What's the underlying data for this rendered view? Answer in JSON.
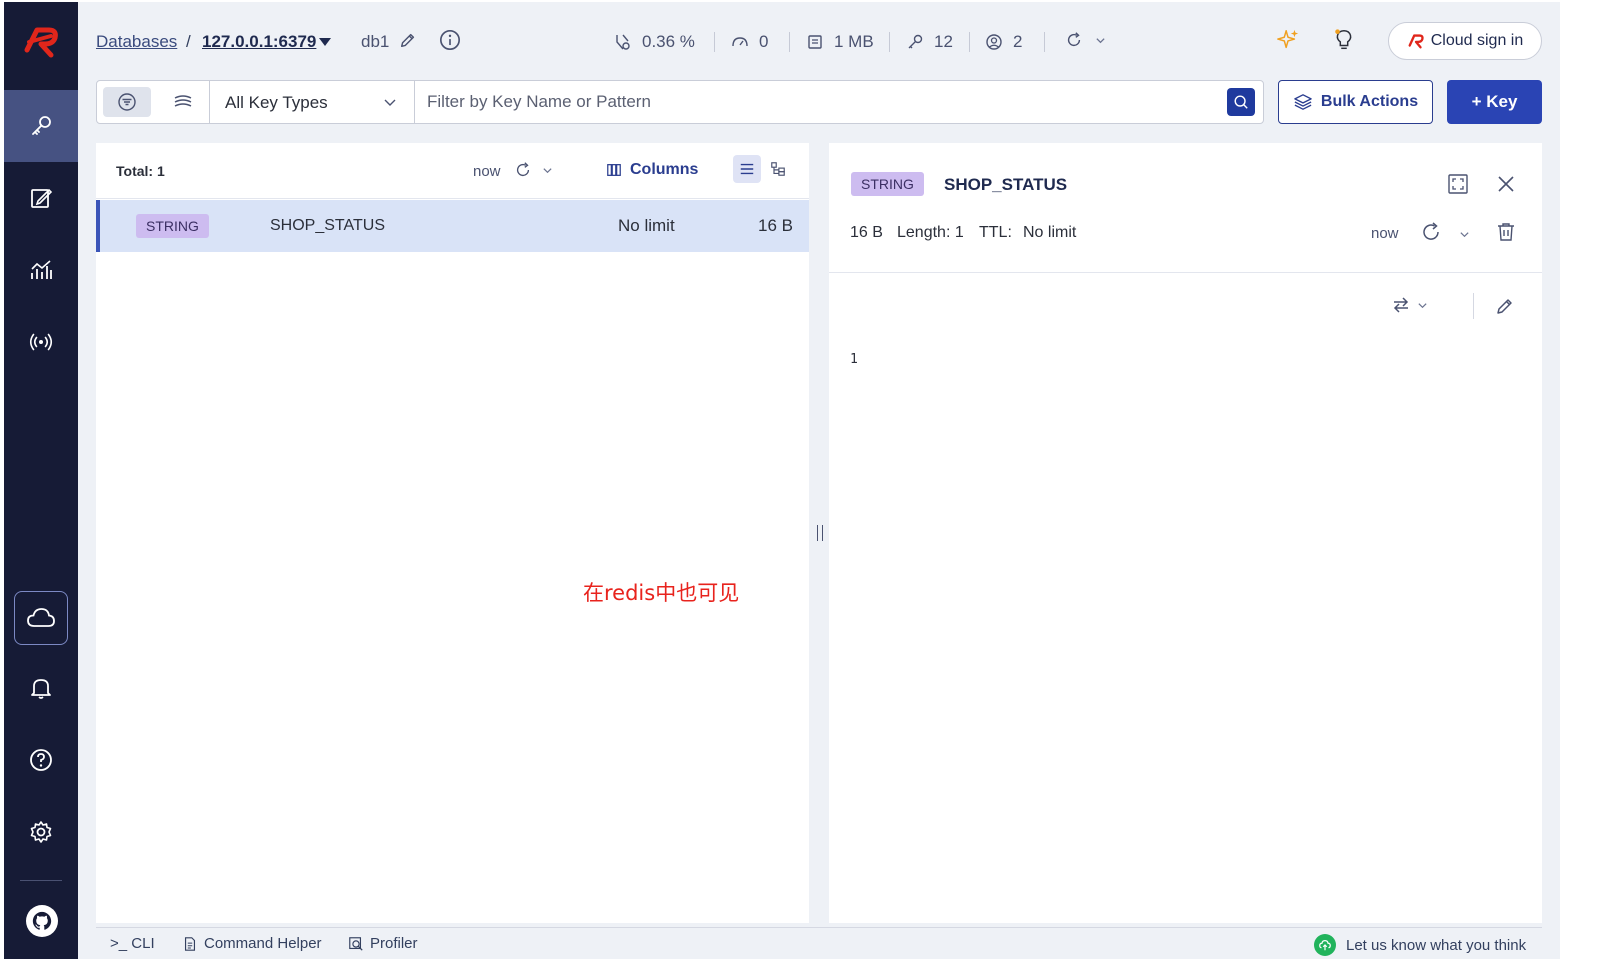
{
  "sidebar": {
    "items": [
      {
        "name": "browser",
        "icon": "key-icon",
        "active": true
      },
      {
        "name": "workbench",
        "icon": "edit-icon"
      },
      {
        "name": "analysis",
        "icon": "chart-icon"
      },
      {
        "name": "pubsub",
        "icon": "broadcast-icon"
      }
    ],
    "bottom": [
      {
        "name": "cloud",
        "icon": "cloud-icon"
      },
      {
        "name": "notifications",
        "icon": "bell-icon"
      },
      {
        "name": "help",
        "icon": "help-icon"
      },
      {
        "name": "settings",
        "icon": "gear-icon"
      },
      {
        "name": "github",
        "icon": "github-icon"
      }
    ]
  },
  "header": {
    "breadcrumb_databases": "Databases",
    "breadcrumb_sep": "/",
    "host": "127.0.0.1:6379",
    "db": "db1",
    "stats": {
      "cpu": "0.36 %",
      "ops": "0",
      "memory": "1 MB",
      "keys": "12",
      "clients": "2"
    },
    "cloud_sign_in": "Cloud sign in"
  },
  "filter": {
    "key_type": "All Key Types",
    "placeholder": "Filter by Key Name or Pattern",
    "bulk_actions": "Bulk Actions",
    "add_key": "+ Key"
  },
  "key_list": {
    "total": "Total: 1",
    "refresh_time": "now",
    "columns_label": "Columns",
    "rows": [
      {
        "type": "STRING",
        "name": "SHOP_STATUS",
        "ttl": "No limit",
        "size": "16 B"
      }
    ]
  },
  "annotation": "在redis中也可见",
  "details": {
    "type": "STRING",
    "name": "SHOP_STATUS",
    "size": "16 B",
    "length": "Length: 1",
    "ttl_label": "TTL:",
    "ttl_value": "No limit",
    "refresh_time": "now",
    "value": "1"
  },
  "bottom_bar": {
    "cli": ">_ CLI",
    "command_helper": "Command Helper",
    "profiler": "Profiler",
    "feedback": "Let us know what you think"
  },
  "colors": {
    "sidebar_bg": "#161b36",
    "sidebar_active": "#465282",
    "primary": "#2a44b4",
    "badge_string": "#cdbcf0",
    "selected_row": "#d9e3f7",
    "annotation": "#e8231d",
    "redis_red": "#e0261b"
  }
}
